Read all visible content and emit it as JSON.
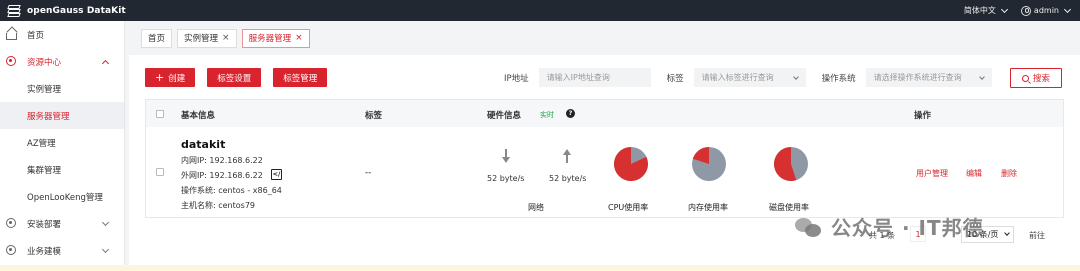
{
  "app": {
    "title": "openGauss DataKit"
  },
  "topbar": {
    "language": "简体中文",
    "user": "admin"
  },
  "sidebar": {
    "items": [
      {
        "label": "首页",
        "icon": "home-icon"
      },
      {
        "label": "资源中心",
        "icon": "gear-icon",
        "expanded": true
      },
      {
        "label": "实例管理"
      },
      {
        "label": "服务器管理",
        "active": true
      },
      {
        "label": "AZ管理"
      },
      {
        "label": "集群管理"
      },
      {
        "label": "OpenLooKeng管理"
      },
      {
        "label": "安装部署",
        "icon": "gear-icon"
      },
      {
        "label": "业务建模",
        "icon": "gear-icon"
      }
    ]
  },
  "tabs": [
    {
      "label": "首页"
    },
    {
      "label": "实例管理",
      "closable": true
    },
    {
      "label": "服务器管理",
      "closable": true,
      "active": true
    }
  ],
  "toolbar": {
    "create": "创建",
    "tag_settings": "标签设置",
    "tag_manage": "标签管理"
  },
  "filters": {
    "ip_label": "IP地址",
    "ip_placeholder": "请输入IP地址查询",
    "tag_label": "标签",
    "tag_placeholder": "请输入标签进行查询",
    "os_label": "操作系统",
    "os_placeholder": "请选择操作系统进行查询",
    "search": "搜索"
  },
  "table": {
    "headers": {
      "basic": "基本信息",
      "tags": "标签",
      "hardware": "硬件信息",
      "realtime": "实时",
      "ops": "操作"
    },
    "row": {
      "hostname": "datakit",
      "internal_ip": "内网IP:  192.168.6.22",
      "external_ip": "外网IP:  192.168.6.22",
      "os": "操作系统:  centos - x86_64",
      "host": "主机名称:  centos79",
      "tags": "--",
      "down_rate": "52 byte/s",
      "up_rate": "52 byte/s",
      "network_label": "网络",
      "cpu_label": "CPU使用率",
      "mem_label": "内存使用率",
      "disk_label": "磁盘使用率",
      "cpu_usage": 0.82,
      "mem_usage": 0.2,
      "disk_usage": 0.55,
      "ops": [
        "用户管理",
        "编辑",
        "删除"
      ]
    }
  },
  "pagination": {
    "total": "共 1 条",
    "page": "1",
    "page_size": "10 条/页",
    "goto": "前往"
  },
  "watermark": {
    "text": "公众号 · IT邦德"
  },
  "colors": {
    "accent": "#d9232d",
    "pie_used": "#d63030",
    "pie_free": "#8f99a6"
  }
}
